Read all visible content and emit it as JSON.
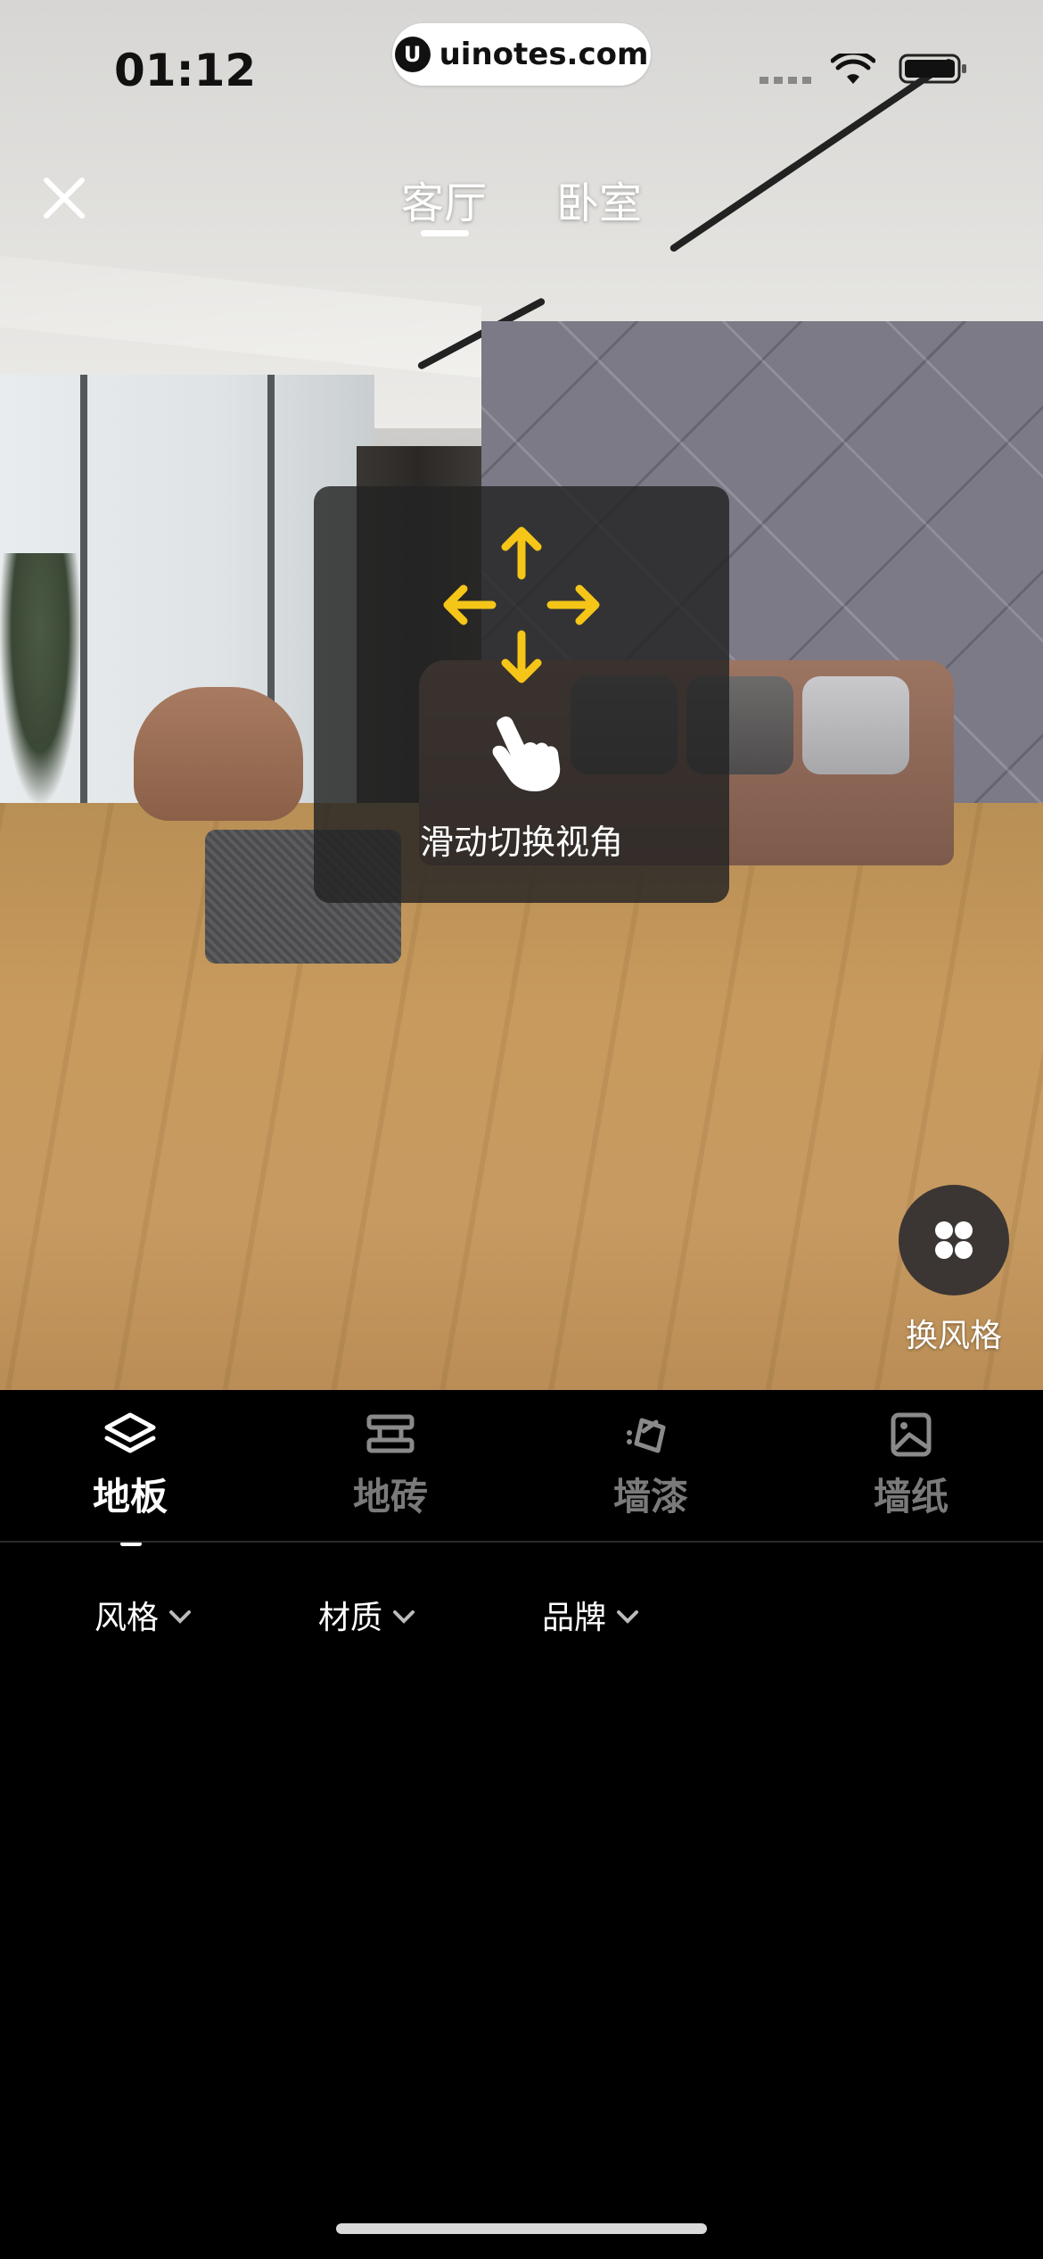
{
  "status_bar": {
    "time": "01:12",
    "url": "uinotes.com",
    "url_logo": "U"
  },
  "top_nav": {
    "tabs": [
      {
        "label": "客厅",
        "active": true
      },
      {
        "label": "卧室",
        "active": false
      }
    ]
  },
  "hint": {
    "text": "滑动切换视角",
    "arrow_color": "#F5C518"
  },
  "style_button": {
    "label": "换风格"
  },
  "categories": [
    {
      "label": "地板",
      "icon": "layers-icon",
      "active": true
    },
    {
      "label": "地砖",
      "icon": "tiles-icon",
      "active": false
    },
    {
      "label": "墙漆",
      "icon": "paint-bucket-icon",
      "active": false
    },
    {
      "label": "墙纸",
      "icon": "wallpaper-icon",
      "active": false
    }
  ],
  "filters": [
    {
      "label": "风格"
    },
    {
      "label": "材质"
    },
    {
      "label": "品牌"
    }
  ]
}
